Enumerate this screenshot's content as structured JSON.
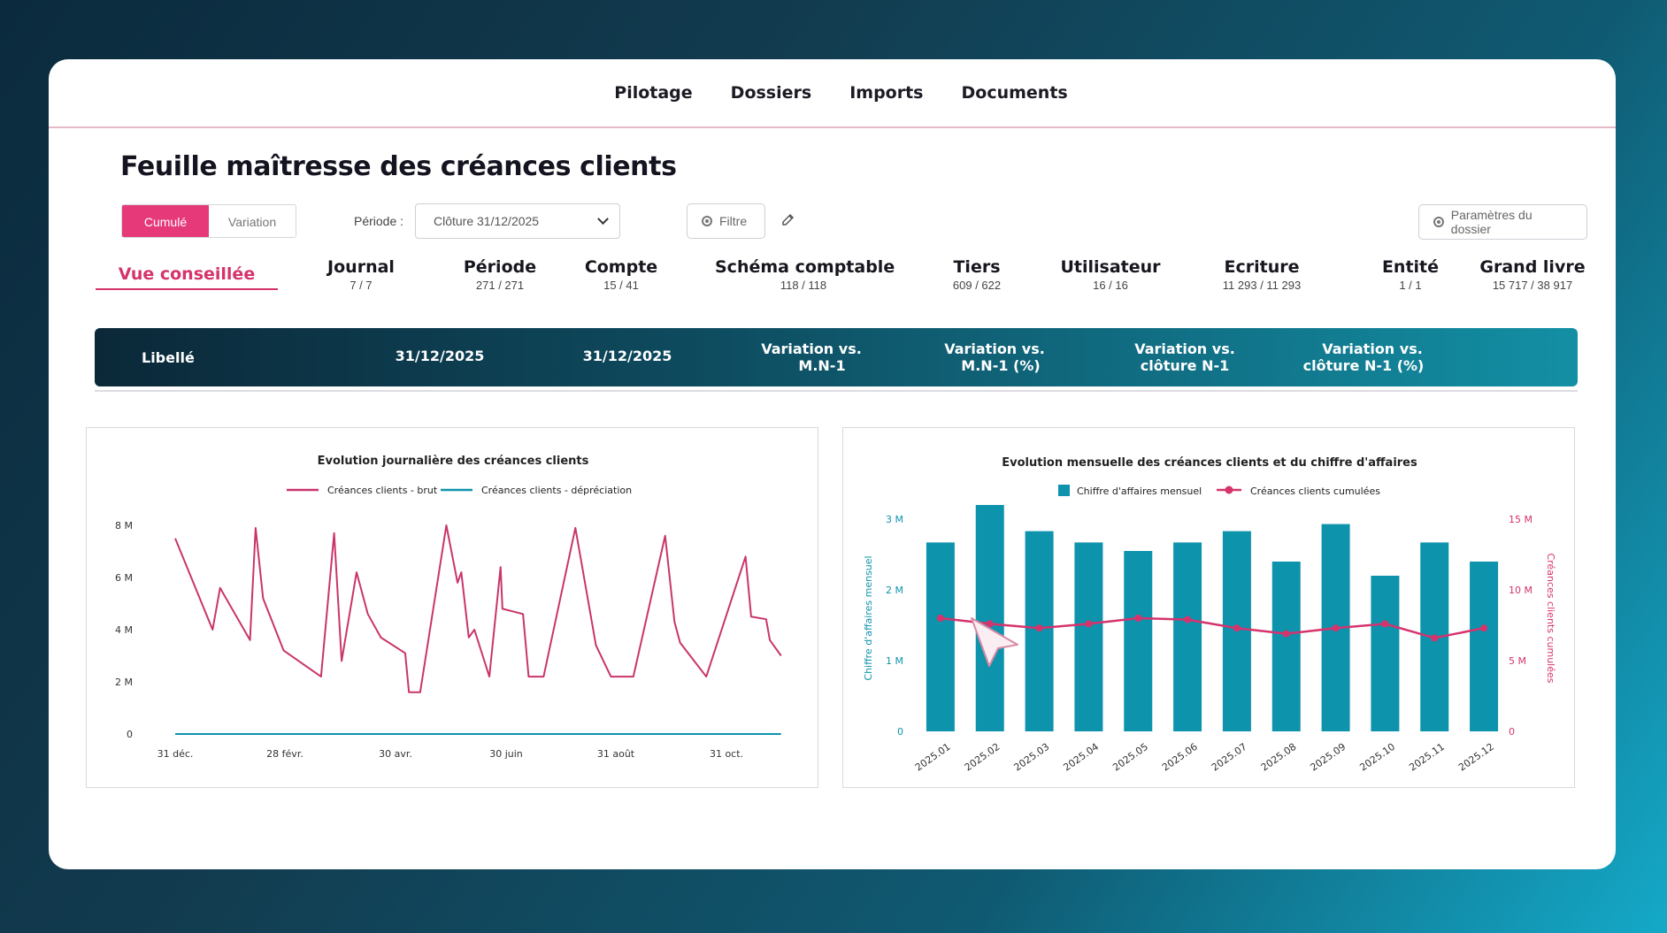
{
  "nav": [
    "Pilotage",
    "Dossiers",
    "Imports",
    "Documents"
  ],
  "page_title": "Feuille maîtresse des créances clients",
  "toggle": {
    "cumule": "Cumulé",
    "variation": "Variation"
  },
  "periode": {
    "label": "Période :",
    "value": "Clôture 31/12/2025"
  },
  "filtre_label": "Filtre",
  "params_label": "Paramètres du dossier",
  "tabs": [
    {
      "label": "Vue conseillée",
      "count": ""
    },
    {
      "label": "Journal",
      "count": "7 / 7"
    },
    {
      "label": "Période",
      "count": "271 / 271"
    },
    {
      "label": "Compte",
      "count": "15 / 41"
    },
    {
      "label": "Schéma comptable",
      "count": "118 / 118"
    },
    {
      "label": "Tiers",
      "count": "609 / 622"
    },
    {
      "label": "Utilisateur",
      "count": "16 / 16"
    },
    {
      "label": "Ecriture",
      "count": "11 293 / 11 293"
    },
    {
      "label": "Entité",
      "count": "1 / 1"
    },
    {
      "label": "Grand livre",
      "count": "15 717 / 38 917"
    }
  ],
  "table_header": {
    "libelle": "Libellé",
    "date1": "31/12/2025",
    "date2": "31/12/2025",
    "var_mn1": [
      "Variation vs.",
      "M.N-1"
    ],
    "var_mn1_pct": [
      "Variation vs.",
      "M.N-1 (%)"
    ],
    "var_cloture": [
      "Variation vs.",
      "clôture N-1"
    ],
    "var_cloture_pct": [
      "Variation vs.",
      "clôture N-1 (%)"
    ]
  },
  "colors": {
    "accent": "#e6397a",
    "line_brut": "#c9356b",
    "teal": "#0e93ad"
  },
  "chart_data": [
    {
      "type": "line",
      "title": "Evolution journalière des créances clients",
      "x_ticks": [
        "31 déc.",
        "28 févr.",
        "30 avr.",
        "30 juin",
        "31 août",
        "31 oct."
      ],
      "y_ticks": [
        "0",
        "2 M",
        "4 M",
        "6 M",
        "8 M"
      ],
      "ylim": [
        0,
        8
      ],
      "xlim": [
        0,
        335
      ],
      "series": [
        {
          "name": "Créances clients - brut",
          "color": "#c9356b",
          "points": [
            [
              0,
              7.5
            ],
            [
              20,
              4.0
            ],
            [
              24,
              5.6
            ],
            [
              40,
              3.6
            ],
            [
              43,
              7.9
            ],
            [
              47,
              5.2
            ],
            [
              58,
              3.2
            ],
            [
              78,
              2.2
            ],
            [
              85,
              7.7
            ],
            [
              89,
              2.8
            ],
            [
              97,
              6.2
            ],
            [
              103,
              4.6
            ],
            [
              110,
              3.7
            ],
            [
              123,
              3.1
            ],
            [
              125,
              1.6
            ],
            [
              131,
              1.6
            ],
            [
              145,
              8.0
            ],
            [
              151,
              5.8
            ],
            [
              153,
              6.2
            ],
            [
              157,
              3.7
            ],
            [
              160,
              4.0
            ],
            [
              168,
              2.2
            ],
            [
              174,
              6.4
            ],
            [
              175,
              4.8
            ],
            [
              186,
              4.6
            ],
            [
              189,
              2.2
            ],
            [
              197,
              2.2
            ],
            [
              214,
              7.9
            ],
            [
              225,
              3.4
            ],
            [
              233,
              2.2
            ],
            [
              245,
              2.2
            ],
            [
              262,
              7.6
            ],
            [
              267,
              4.3
            ],
            [
              270,
              3.5
            ],
            [
              284,
              2.2
            ],
            [
              305,
              6.8
            ],
            [
              308,
              4.5
            ],
            [
              316,
              4.4
            ],
            [
              318,
              3.6
            ],
            [
              324,
              3.0
            ]
          ]
        },
        {
          "name": "Créances clients - dépréciation",
          "color": "#0e93ad",
          "points": [
            [
              0,
              0
            ],
            [
              324,
              0
            ]
          ]
        }
      ]
    },
    {
      "type": "bar+line",
      "title": "Evolution mensuelle des créances clients et du chiffre d'affaires",
      "categories": [
        "2025.01",
        "2025.02",
        "2025.03",
        "2025.04",
        "2025.05",
        "2025.06",
        "2025.07",
        "2025.08",
        "2025.09",
        "2025.10",
        "2025.11",
        "2025.12"
      ],
      "ylabel_left": "Chiffre d'affaires mensuel",
      "ylabel_right": "Créances clients cumulées",
      "y_left_ticks": [
        "0",
        "1 M",
        "2 M",
        "3 M"
      ],
      "y_right_ticks": [
        "0",
        "5 M",
        "10 M",
        "15 M"
      ],
      "ylim_left": [
        0,
        3
      ],
      "ylim_right": [
        0,
        15
      ],
      "series": [
        {
          "name": "Chiffre d'affaires mensuel",
          "type": "bar",
          "axis": "left",
          "color": "#0e93ad",
          "values": [
            2.67,
            3.2,
            2.83,
            2.67,
            2.55,
            2.67,
            2.83,
            2.4,
            2.93,
            2.2,
            2.67,
            2.4
          ]
        },
        {
          "name": "Créances clients cumulées",
          "type": "line",
          "axis": "right",
          "color": "#d6336c",
          "values": [
            8.0,
            7.6,
            7.3,
            7.6,
            8.0,
            7.9,
            7.3,
            6.9,
            7.3,
            7.6,
            6.6,
            7.3
          ]
        }
      ]
    }
  ]
}
